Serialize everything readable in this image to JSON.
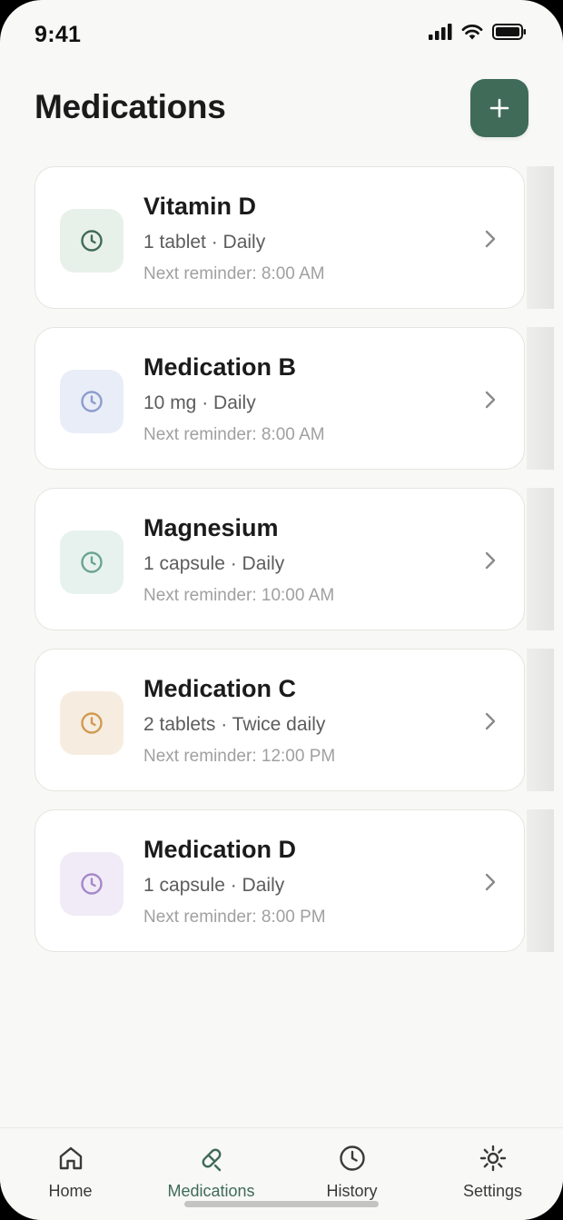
{
  "status_bar": {
    "time": "9:41",
    "icons": [
      "signal-icon",
      "wifi-icon",
      "battery-icon"
    ]
  },
  "header": {
    "title": "Medications",
    "add_button_icon": "plus-icon"
  },
  "colors": {
    "accent": "#3f6b58",
    "background": "#f8f8f6"
  },
  "medications": [
    {
      "name": "Vitamin D",
      "dose": "1 tablet · Daily",
      "reminder": "Next reminder: 8:00 AM",
      "icon": "clock-icon",
      "icon_color": "#3f6b58",
      "icon_bg": "#e8f0ea"
    },
    {
      "name": "Medication B",
      "dose": "10 mg · Daily",
      "reminder": "Next reminder: 8:00 AM",
      "icon": "clock-icon",
      "icon_color": "#8d9ccc",
      "icon_bg": "#e9edf8"
    },
    {
      "name": "Magnesium",
      "dose": "1 capsule · Daily",
      "reminder": "Next reminder: 10:00 AM",
      "icon": "clock-icon",
      "icon_color": "#6ba48f",
      "icon_bg": "#e7f2ee"
    },
    {
      "name": "Medication C",
      "dose": "2 tablets · Twice daily",
      "reminder": "Next reminder: 12:00 PM",
      "icon": "clock-icon",
      "icon_color": "#d09a50",
      "icon_bg": "#f6ece0"
    },
    {
      "name": "Medication D",
      "dose": "1 capsule · Daily",
      "reminder": "Next reminder: 8:00 PM",
      "icon": "clock-icon",
      "icon_color": "#a587c9",
      "icon_bg": "#f1ebf7"
    }
  ],
  "tabs": [
    {
      "label": "Home",
      "icon": "home-icon",
      "active": false
    },
    {
      "label": "Medications",
      "icon": "pill-icon",
      "active": true
    },
    {
      "label": "History",
      "icon": "clock-icon",
      "active": false
    },
    {
      "label": "Settings",
      "icon": "gear-icon",
      "active": false
    }
  ]
}
